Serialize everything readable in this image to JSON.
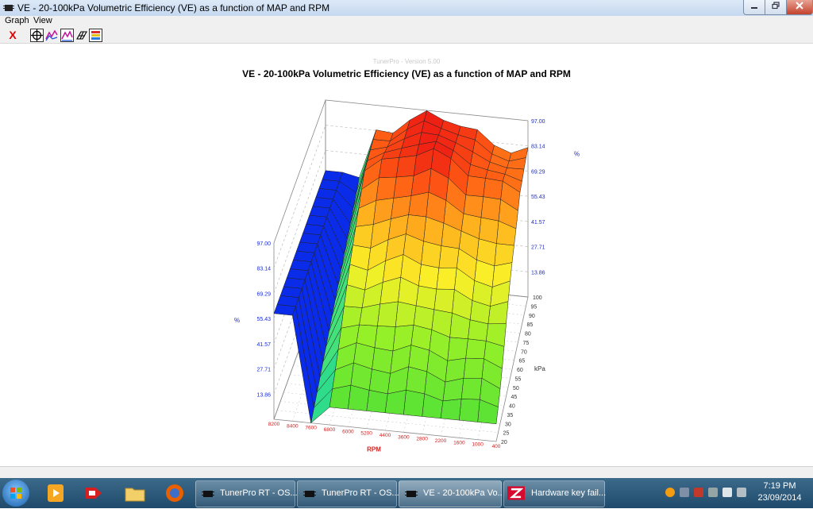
{
  "window": {
    "title": "VE - 20-100kPa Volumetric Efficiency (VE) as a function of MAP and RPM"
  },
  "menu": {
    "graph": "Graph",
    "view": "View"
  },
  "toolbar": {
    "close": "X"
  },
  "graph": {
    "watermark": "TunerPro - Version 5.00",
    "title": "VE - 20-100kPa Volumetric Efficiency (VE) as a function of MAP and RPM"
  },
  "chart_data": {
    "type": "surface3d",
    "title": "VE - 20-100kPa Volumetric Efficiency (VE) as a function of MAP and RPM",
    "z_label": "%",
    "z_ticks": [
      "13.86",
      "27.71",
      "41.57",
      "55.43",
      "69.29",
      "83.14",
      "97.00"
    ],
    "x_label": "RPM",
    "x_ticks": [
      "8200",
      "8400",
      "7600",
      "6800",
      "6000",
      "5200",
      "4400",
      "3600",
      "2800",
      "2200",
      "1600",
      "1000",
      "400"
    ],
    "y_label": "kPa",
    "y_ticks": [
      "20",
      "25",
      "30",
      "35",
      "40",
      "45",
      "50",
      "55",
      "60",
      "65",
      "70",
      "75",
      "80",
      "85",
      "90",
      "95",
      "100"
    ],
    "zlim": [
      0,
      97.0
    ]
  },
  "taskbar": {
    "tasks": [
      {
        "label": "TunerPro RT - OS..."
      },
      {
        "label": "TunerPro RT - OS..."
      },
      {
        "label": "VE - 20-100kPa Vo..."
      },
      {
        "label": "Hardware key fail..."
      }
    ],
    "clock_time": "7:19 PM",
    "clock_date": "23/09/2014"
  }
}
